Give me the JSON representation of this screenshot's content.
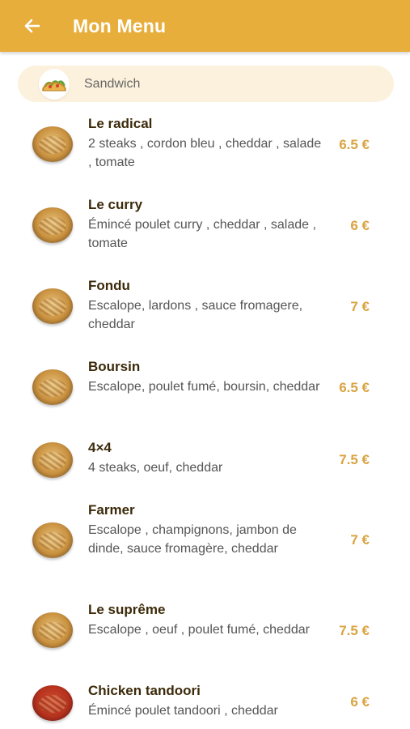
{
  "header": {
    "title": "Mon Menu",
    "back_icon": "arrow-left-icon",
    "color": "#E8AE3C"
  },
  "category": {
    "label": "Sandwich",
    "icon": "taco-icon",
    "background": "#FCF1DC"
  },
  "items": [
    {
      "name": "Le radical",
      "description": "2 steaks , cordon bleu , cheddar , salade , tomate",
      "price": "6.5 €"
    },
    {
      "name": "Le curry",
      "description": "Émincé poulet curry , cheddar , salade , tomate",
      "price": "6 €"
    },
    {
      "name": "Fondu",
      "description": "Escalope, lardons , sauce fromagere, cheddar",
      "price": "7 €"
    },
    {
      "name": "Boursin",
      "description": "Escalope, poulet fumé, boursin, cheddar",
      "price": "6.5 €"
    },
    {
      "name": "4×4",
      "description": "4 steaks, oeuf, cheddar",
      "price": "7.5 €"
    },
    {
      "name": "Farmer",
      "description": "Escalope , champignons, jambon de dinde, sauce fromagère, cheddar",
      "price": "7 €"
    },
    {
      "name": "Le suprême",
      "description": "Escalope , oeuf , poulet fumé, cheddar",
      "price": "7.5 €"
    },
    {
      "name": "Chicken tandoori",
      "description": "Émincé poulet tandoori , cheddar",
      "price": "6 €"
    }
  ],
  "price_color": "#D9A441"
}
